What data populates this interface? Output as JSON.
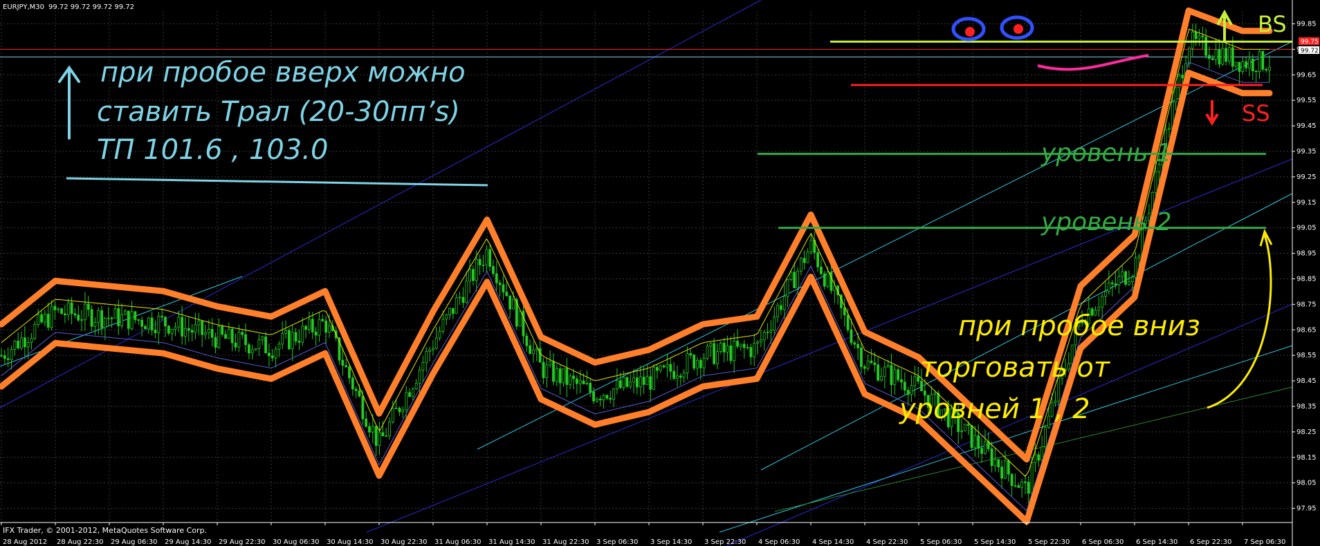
{
  "header": {
    "symbol": "EURJPY,M30",
    "ohlc": "99.72 99.72 99.72 99.72"
  },
  "footer": {
    "copyright": "IFX Trader, © 2001-2012, MetaQuotes Software Corp."
  },
  "price_tags": {
    "red_line": "99.75",
    "current": "99.72"
  },
  "annotations": {
    "top_left": [
      "при пробое вверх можно",
      "ставить Трал (20-30пп’s)",
      "ТП 101.6 , 103.0"
    ],
    "bottom_right": [
      "при пробое вниз",
      "торговать от",
      "уровней 1 , 2"
    ],
    "level1": "уровень 1",
    "level2": "уровень 2",
    "bs": "BS",
    "ss": "SS"
  },
  "colors": {
    "background": "#000000",
    "grid": "#3a3a3a",
    "candle": "#22cc22",
    "orange_outline": "#ff7f2a",
    "annotation_blue": "#7fd3e6",
    "annotation_yellow": "#ffee00",
    "level_green": "#33aa44",
    "red_line": "#ff2020",
    "current_line": "#7fd3e6"
  },
  "chart_data": {
    "type": "candlestick",
    "symbol": "EURJPY",
    "timeframe": "M30",
    "y_ticks": [
      "99.85",
      "99.75",
      "99.65",
      "99.55",
      "99.45",
      "99.35",
      "99.25",
      "99.15",
      "99.05",
      "98.95",
      "98.85",
      "98.75",
      "98.65",
      "98.55",
      "98.45",
      "98.35",
      "98.25",
      "98.15",
      "98.05",
      "97.95"
    ],
    "x_ticks": [
      "28 Aug 2012",
      "28 Aug 22:30",
      "29 Aug 06:30",
      "29 Aug 14:30",
      "29 Aug 22:30",
      "30 Aug 06:30",
      "30 Aug 14:30",
      "30 Aug 22:30",
      "31 Aug 06:30",
      "31 Aug 14:30",
      "31 Aug 22:30",
      "3 Sep 06:30",
      "3 Sep 14:30",
      "3 Sep 22:30",
      "4 Sep 06:30",
      "4 Sep 14:30",
      "4 Sep 22:30",
      "5 Sep 06:30",
      "5 Sep 14:30",
      "5 Sep 22:30",
      "6 Sep 06:30",
      "6 Sep 14:30",
      "6 Sep 22:30",
      "7 Sep 06:30"
    ],
    "ylim": [
      97.9,
      99.9
    ],
    "price_path": [
      [
        0,
        98.55
      ],
      [
        1,
        98.72
      ],
      [
        2,
        98.7
      ],
      [
        3,
        98.68
      ],
      [
        4,
        98.62
      ],
      [
        5,
        98.58
      ],
      [
        6,
        98.68
      ],
      [
        7,
        98.2
      ],
      [
        8,
        98.6
      ],
      [
        9,
        98.96
      ],
      [
        10,
        98.5
      ],
      [
        11,
        98.4
      ],
      [
        12,
        98.45
      ],
      [
        13,
        98.55
      ],
      [
        14,
        98.58
      ],
      [
        15,
        98.98
      ],
      [
        16,
        98.52
      ],
      [
        17,
        98.42
      ],
      [
        18,
        98.22
      ],
      [
        19,
        98.02
      ],
      [
        20,
        98.7
      ],
      [
        21,
        98.9
      ],
      [
        22,
        99.78
      ],
      [
        23,
        99.7
      ],
      [
        23.5,
        99.7
      ]
    ],
    "horizontal_levels": [
      {
        "name": "уровень 1",
        "value": 99.34
      },
      {
        "name": "уровень 2",
        "value": 99.05
      },
      {
        "name": "BS",
        "value": 99.78
      },
      {
        "name": "SS",
        "value": 99.61
      }
    ]
  }
}
